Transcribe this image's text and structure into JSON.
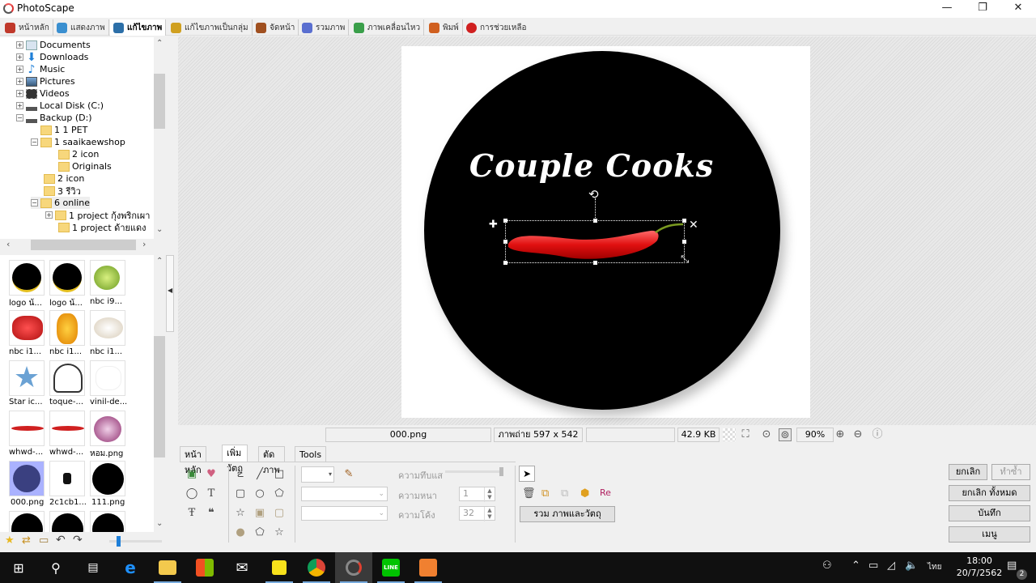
{
  "window": {
    "title": "PhotoScape",
    "controls": {
      "minimize": "—",
      "maximize": "❐",
      "close": "✕"
    }
  },
  "main_tabs": [
    {
      "label": "หน้าหลัก",
      "icon": "home-icon",
      "color": "#c0392b",
      "active": false
    },
    {
      "label": "แสดงภาพ",
      "icon": "viewer-icon",
      "color": "#3a8fd0",
      "active": false
    },
    {
      "label": "แก้ไขภาพ",
      "icon": "editor-icon",
      "color": "#2c6fa8",
      "active": true
    },
    {
      "label": "แก้ไขภาพเป็นกลุ่ม",
      "icon": "batch-editor-icon",
      "color": "#d0a020",
      "active": false
    },
    {
      "label": "จัดหน้า",
      "icon": "page-icon",
      "color": "#a05020",
      "active": false
    },
    {
      "label": "รวมภาพ",
      "icon": "combine-icon",
      "color": "#5a6fd0",
      "active": false
    },
    {
      "label": "ภาพเคลื่อนไหว",
      "icon": "animated-gif-icon",
      "color": "#3a9f4a",
      "active": false
    },
    {
      "label": "พิมพ์",
      "icon": "print-icon",
      "color": "#d06020",
      "active": false
    },
    {
      "label": "การช่วยเหลือ",
      "icon": "help-icon",
      "color": "#d02020",
      "active": false
    }
  ],
  "folder_tree": [
    {
      "label": "Documents",
      "icon": "documents-icon",
      "expander": "+"
    },
    {
      "label": "Downloads",
      "icon": "downloads-icon",
      "expander": "+"
    },
    {
      "label": "Music",
      "icon": "music-icon",
      "expander": "+"
    },
    {
      "label": "Pictures",
      "icon": "pictures-icon",
      "expander": "+"
    },
    {
      "label": "Videos",
      "icon": "videos-icon",
      "expander": "+"
    },
    {
      "label": "Local Disk (C:)",
      "icon": "drive-icon",
      "expander": "+"
    },
    {
      "label": "Backup (D:)",
      "icon": "drive-icon",
      "expander": "−"
    },
    {
      "label": "1 1 PET",
      "icon": "folder-icon",
      "expander": ""
    },
    {
      "label": "1 saaikaewshop",
      "icon": "folder-icon",
      "expander": "−"
    },
    {
      "label": "2 icon",
      "icon": "folder-icon",
      "expander": ""
    },
    {
      "label": "Originals",
      "icon": "folder-icon",
      "expander": ""
    },
    {
      "label": "2 icon",
      "icon": "folder-icon",
      "expander": ""
    },
    {
      "label": "3 รีวิว",
      "icon": "folder-icon",
      "expander": ""
    },
    {
      "label": "6 online",
      "icon": "folder-icon",
      "expander": "−",
      "selected": true
    },
    {
      "label": "1 project กุ้งพริกเผา",
      "icon": "folder-icon",
      "expander": "+"
    },
    {
      "label": "1 project ด้ายแดง",
      "icon": "folder-icon",
      "expander": ""
    }
  ],
  "thumbnails": [
    {
      "label": "logo น้...",
      "kind": "logo"
    },
    {
      "label": "logo น้...",
      "kind": "logo"
    },
    {
      "label": "nbc i9...",
      "kind": "lime"
    },
    {
      "label": "nbc i1...",
      "kind": "red-pepper"
    },
    {
      "label": "nbc i1...",
      "kind": "yellow-pepper"
    },
    {
      "label": "nbc i1...",
      "kind": "garlic"
    },
    {
      "label": "Star ic...",
      "kind": "star"
    },
    {
      "label": "toque-...",
      "kind": "chef-hat"
    },
    {
      "label": "vinil-de...",
      "kind": "faint"
    },
    {
      "label": "whwd-...",
      "kind": "chili"
    },
    {
      "label": "whwd-...",
      "kind": "chili"
    },
    {
      "label": "หอม.png",
      "kind": "onion"
    },
    {
      "label": "000.png",
      "kind": "blue-circle",
      "selected": true
    },
    {
      "label": "2c1cb1...",
      "kind": "chef"
    },
    {
      "label": "111.png",
      "kind": "logo-dark"
    },
    {
      "label": "",
      "kind": "logo-dark"
    },
    {
      "label": "",
      "kind": "logo-dark"
    },
    {
      "label": "",
      "kind": "logo-dark"
    }
  ],
  "thumb_toolbar": {
    "icons": [
      "favorite-star-icon",
      "refresh-icon",
      "open-folder-icon",
      "back-icon",
      "forward-icon"
    ],
    "thumb_size_fraction": 0.15
  },
  "canvas": {
    "title_text": "Couple Cooks",
    "object_handles": {
      "add": "✚",
      "delete": "✕",
      "rotate": "⟲",
      "resize": "⤡"
    }
  },
  "status": {
    "filename": "000.png",
    "dimensions": "ภาพถ่าย 597 x 542",
    "extra": "",
    "filesize": "42.9 KB",
    "zoom": "90%"
  },
  "bottom_tabs": [
    {
      "label": "หน้าหลัก",
      "active": false
    },
    {
      "label": "เพิ่มวัตถุ",
      "active": true
    },
    {
      "label": "ตัดภาพ",
      "active": false
    },
    {
      "label": "Tools",
      "active": false
    }
  ],
  "object_tools": {
    "opacity_label": "ความทึบแส",
    "thickness_label": "ความหนา",
    "thickness_value": "1",
    "curve_label": "ความโค้ง",
    "curve_value": "32",
    "combine_button": "รวม ภาพและวัตถุ",
    "opacity_fraction": 1.0
  },
  "actions": {
    "undo": "ยกเลิก",
    "redo": "ทำซ้ำ",
    "undo_all": "ยกเลิก ทั้งหมด",
    "save": "บันทึก",
    "menu": "เมนู"
  },
  "taskbar": {
    "apps": [
      "start-icon",
      "search-icon",
      "task-view-icon",
      "edge-icon",
      "file-explorer-icon",
      "store-icon",
      "mail-icon",
      "sticky-notes-icon",
      "chrome-icon",
      "photoscape-icon",
      "line-icon",
      "app-icon"
    ],
    "time": "18:00",
    "date": "20/7/2562",
    "language": "ไทย",
    "notifications": "2"
  }
}
